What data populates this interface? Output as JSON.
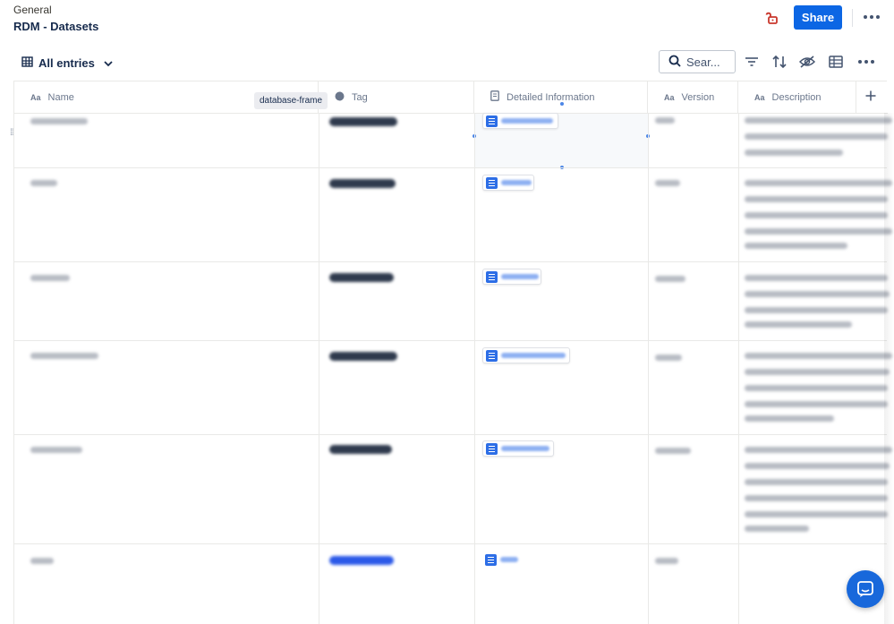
{
  "breadcrumb": "General",
  "title": "RDM - Datasets",
  "top_actions": {
    "share_label": "Share"
  },
  "toolbar": {
    "view_label": "All entries",
    "search_placeholder": "Sear..."
  },
  "columns": [
    "Name",
    "Tag",
    "Detailed Information",
    "Version",
    "Description"
  ],
  "tooltip": "database-frame",
  "colors": {
    "accent": "#0c66e4",
    "lock": "#c9372c",
    "doc_icon": "#2d6ee6"
  },
  "icons": [
    "lock-open-icon",
    "more-icon",
    "table-icon",
    "chevron-down-icon",
    "search-icon",
    "filter-icon",
    "sort-icon",
    "eye-off-icon",
    "layout-icon",
    "plus-icon",
    "document-icon",
    "chat-icon",
    "drag-handle-icon"
  ]
}
